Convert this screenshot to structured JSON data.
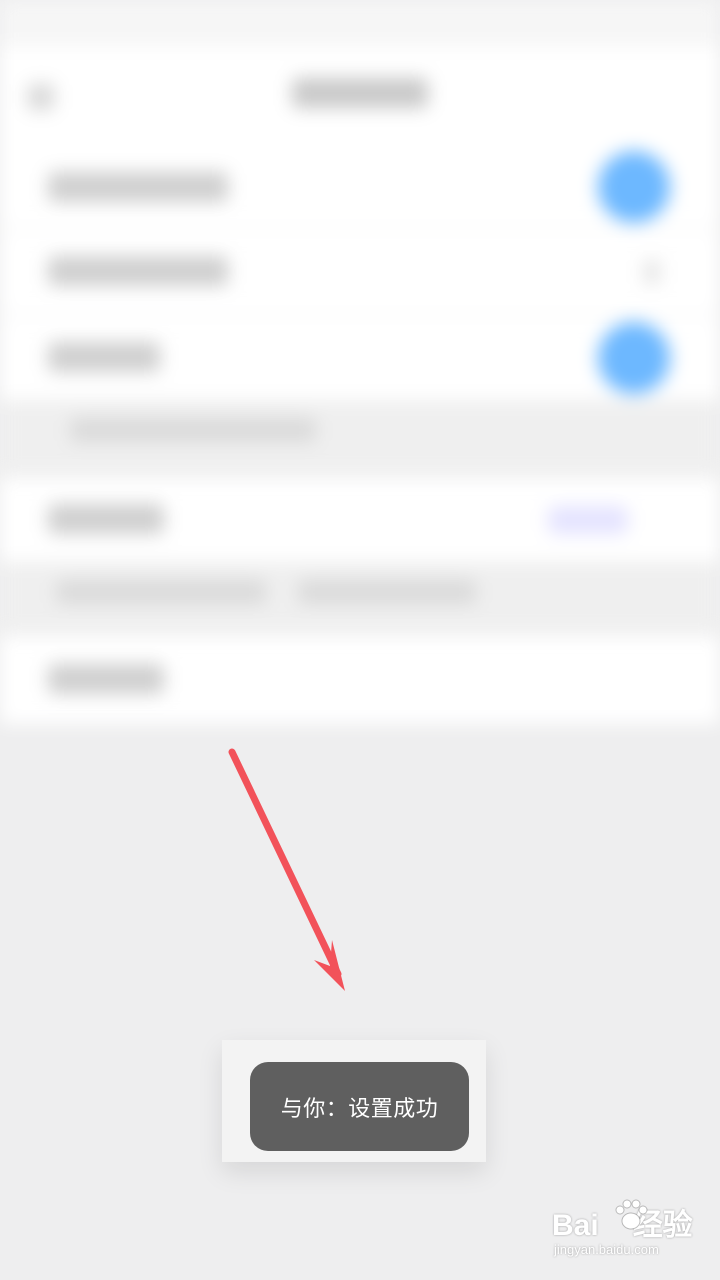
{
  "toast": {
    "message": "与你：设置成功"
  },
  "watermark": {
    "brand_left": "Bai",
    "brand_right": "经验",
    "url": "jingyan.baidu.com"
  },
  "colors": {
    "arrow": "#f2525a",
    "toast_bg": "#5f5f5f",
    "toggle_on": "#6db8ff"
  }
}
